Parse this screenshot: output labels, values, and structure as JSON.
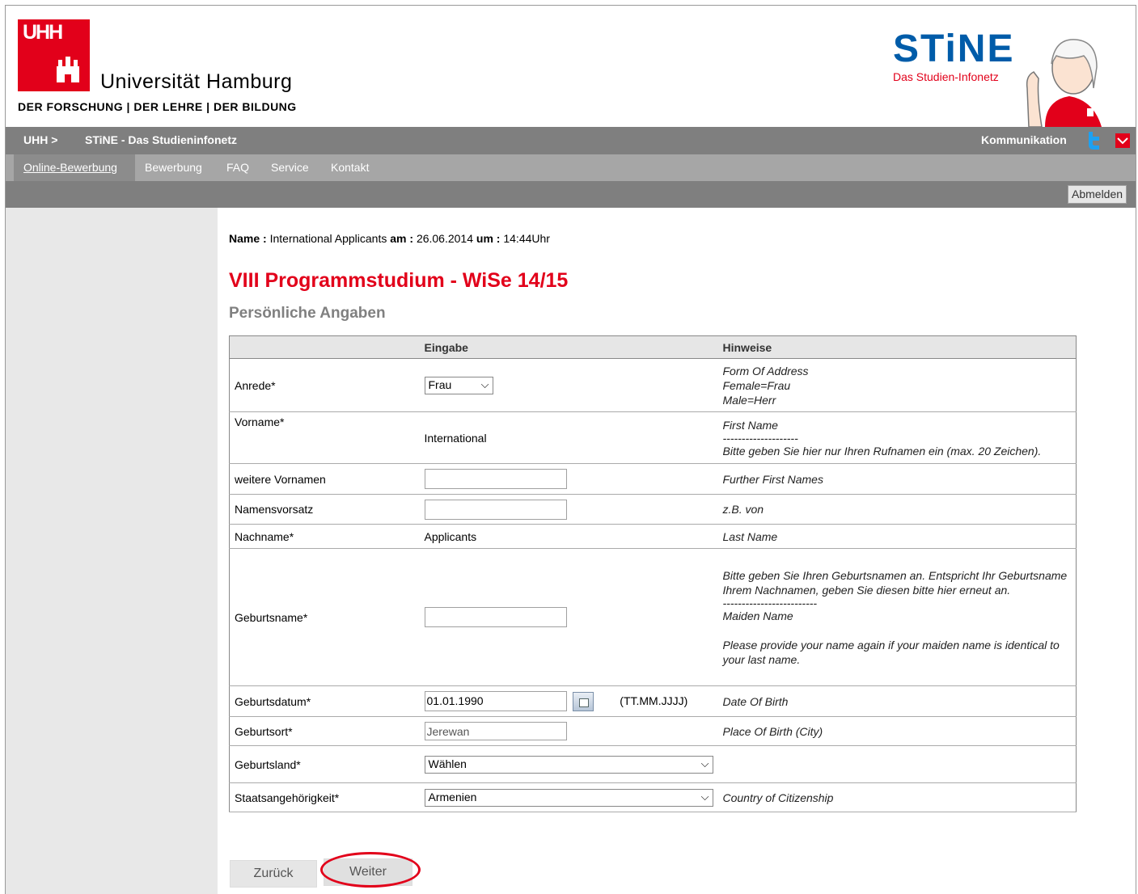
{
  "header": {
    "logo_text": "UHH",
    "university_name": "Universität Hamburg",
    "tagline": "DER FORSCHUNG | DER LEHRE | DER BILDUNG",
    "stine_logo": "STiNE",
    "stine_subtitle": "Das Studien-Infonetz"
  },
  "topbar": {
    "crumb_uhh": "UHH >",
    "crumb_stine": "STiNE - Das Studieninfonetz",
    "kommunikation": "Kommunikation",
    "icons": [
      "twitter-icon",
      "mail-icon"
    ]
  },
  "nav": {
    "items": [
      "Online-Bewerbung",
      "Bewerbung",
      "FAQ",
      "Service",
      "Kontakt"
    ]
  },
  "abmelden": "Abmelden",
  "meta": {
    "name_label": "Name",
    "name_value": "International Applicants",
    "am_label": "am",
    "date": "26.06.2014",
    "um_label": "um",
    "time": "14:44Uhr"
  },
  "title": "VIII Programmstudium - WiSe 14/15",
  "subtitle": "Persönliche Angaben",
  "table": {
    "headers": [
      "",
      "Eingabe",
      "Hinweise"
    ],
    "rows": {
      "anrede": {
        "label": "Anrede*",
        "value": "Frau",
        "hint1": "Form Of Address",
        "hint2": "Female=Frau",
        "hint3": "Male=Herr"
      },
      "vorname": {
        "label": "Vorname*",
        "value": "International",
        "hint1": "First Name",
        "hint2": "--------------------",
        "hint3": "Bitte geben Sie hier nur Ihren Rufnamen ein (max. 20 Zeichen)."
      },
      "weitere": {
        "label": "weitere Vornamen",
        "value": "",
        "hint1": "Further First Names"
      },
      "vorsatz": {
        "label": "Namensvorsatz",
        "value": "",
        "hint1": "z.B. von"
      },
      "nachname": {
        "label": "Nachname*",
        "value": "Applicants",
        "hint1": "Last Name"
      },
      "geburtsname": {
        "label": "Geburtsname*",
        "value": "",
        "hint1": "Bitte geben Sie Ihren Geburtsnamen an. Entspricht Ihr Geburtsname Ihrem Nachnamen, geben Sie diesen bitte hier erneut an.",
        "hint2": "-------------------------",
        "hint3": "Maiden Name",
        "hint4": "Please provide your name again if your maiden name is identical to your last name."
      },
      "geburtsdatum": {
        "label": "Geburtsdatum*",
        "value": "01.01.1990",
        "format": "(TT.MM.JJJJ)",
        "hint1": "Date Of Birth"
      },
      "geburtsort": {
        "label": "Geburtsort*",
        "value": "Jerewan",
        "hint1": "Place Of Birth (City)"
      },
      "geburtsland": {
        "label": "Geburtsland*",
        "value": "Wählen",
        "hint1": ""
      },
      "staat": {
        "label": "Staatsangehörigkeit*",
        "value": "Armenien",
        "hint1": "Country of Citizenship"
      }
    }
  },
  "buttons": {
    "back": "Zurück",
    "next": "Weiter"
  }
}
